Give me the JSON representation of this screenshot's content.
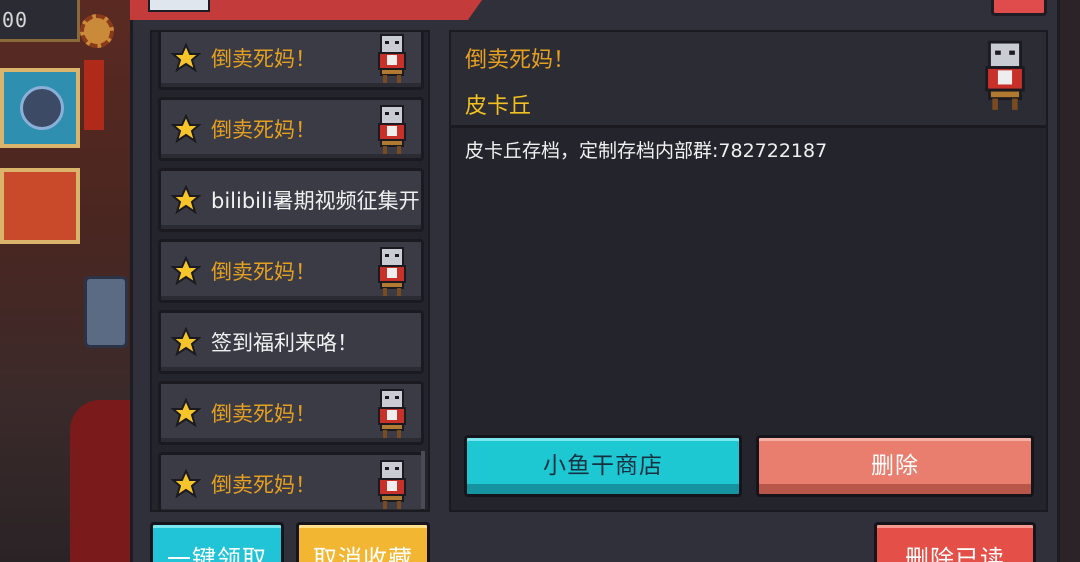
{
  "background": {
    "counter_text": "00"
  },
  "mail_list": {
    "items": [
      {
        "title": "倒卖死妈！",
        "color": "#e6a020",
        "has_avatar": true
      },
      {
        "title": "倒卖死妈！",
        "color": "#e6a020",
        "has_avatar": true
      },
      {
        "title": "bilibili暑期视频征集开",
        "color": "#f0f0f0",
        "has_avatar": false
      },
      {
        "title": "倒卖死妈！",
        "color": "#e6a020",
        "has_avatar": true
      },
      {
        "title": "签到福利来咯！",
        "color": "#f0f0f0",
        "has_avatar": false
      },
      {
        "title": "倒卖死妈！",
        "color": "#e6a020",
        "has_avatar": true
      },
      {
        "title": "倒卖死妈！",
        "color": "#e6a020",
        "has_avatar": true
      }
    ],
    "icon": "star-icon"
  },
  "detail": {
    "title": "倒卖死妈！",
    "sender": "皮卡丘",
    "body": "皮卡丘存档，定制存档内部群:782722187",
    "avatar_icon": "cat-avatar-icon"
  },
  "buttons": {
    "shop": "小鱼干商店",
    "delete": "删除",
    "claim_all": "一键领取",
    "unfavorite": "取消收藏",
    "delete_read": "删除已读"
  },
  "colors": {
    "accent_orange": "#e6a020",
    "cyan": "#1ec8d2",
    "salmon": "#e97d6e",
    "yellow": "#f2b632",
    "red": "#e44f48"
  }
}
